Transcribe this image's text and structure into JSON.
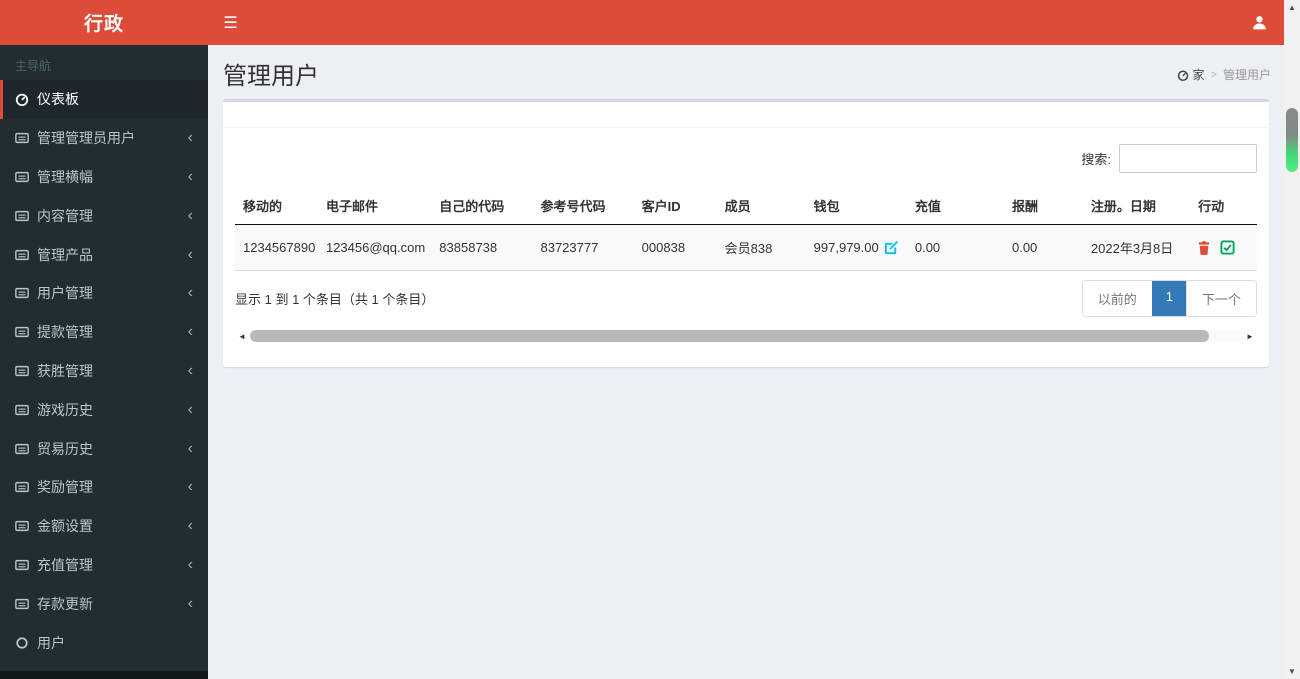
{
  "app": {
    "logo_text": "行政",
    "colors": {
      "accent_red": "#dd4b39",
      "sidebar_bg": "#222d32",
      "active_page_blue": "#337ab7",
      "edit_icon_cyan": "#00c0ef",
      "delete_icon_red": "#dd4b39",
      "check_icon_green": "#00a65a"
    }
  },
  "icons": {
    "hamburger": "☰",
    "chevron_left": "‹",
    "breadcrumb_separator": ">",
    "scroll_left": "◄",
    "scroll_right": "►",
    "scroll_up": "▲",
    "scroll_down": "▼"
  },
  "sidebar": {
    "section_label": "主导航",
    "items": [
      {
        "label": "仪表板",
        "icon": "dashboard-icon",
        "active": true,
        "chevron": false
      },
      {
        "label": "管理管理员用户",
        "icon": "list-icon",
        "active": false,
        "chevron": true
      },
      {
        "label": "管理横幅",
        "icon": "list-icon",
        "active": false,
        "chevron": true
      },
      {
        "label": "内容管理",
        "icon": "list-icon",
        "active": false,
        "chevron": true
      },
      {
        "label": "管理产品",
        "icon": "list-icon",
        "active": false,
        "chevron": true
      },
      {
        "label": "用户管理",
        "icon": "list-icon",
        "active": false,
        "chevron": true
      },
      {
        "label": "提款管理",
        "icon": "list-icon",
        "active": false,
        "chevron": true
      },
      {
        "label": "获胜管理",
        "icon": "list-icon",
        "active": false,
        "chevron": true
      },
      {
        "label": "游戏历史",
        "icon": "list-icon",
        "active": false,
        "chevron": true
      },
      {
        "label": "贸易历史",
        "icon": "list-icon",
        "active": false,
        "chevron": true
      },
      {
        "label": "奖励管理",
        "icon": "list-icon",
        "active": false,
        "chevron": true
      },
      {
        "label": "金额设置",
        "icon": "list-icon",
        "active": false,
        "chevron": true
      },
      {
        "label": "充值管理",
        "icon": "list-icon",
        "active": false,
        "chevron": true
      },
      {
        "label": "存款更新",
        "icon": "list-icon",
        "active": false,
        "chevron": true
      },
      {
        "label": "用户",
        "icon": "circle-icon",
        "active": false,
        "chevron": false
      }
    ]
  },
  "page": {
    "title": "管理用户",
    "breadcrumb": {
      "home_label": "家",
      "current": "管理用户"
    }
  },
  "search": {
    "label": "搜索:",
    "value": ""
  },
  "table": {
    "headers": [
      "移动的",
      "电子邮件",
      "自己的代码",
      "参考号代码",
      "客户ID",
      "成员",
      "钱包",
      "充值",
      "报酬",
      "注册。日期",
      "行动"
    ],
    "rows": [
      {
        "mobile": "1234567890",
        "email": "123456@qq.com",
        "own_code": "83858738",
        "ref_code": "83723777",
        "customer_id": "000838",
        "member": "会员838",
        "wallet": "997,979.00",
        "recharge": "0.00",
        "reward": "0.00",
        "reg_date": "2022年3月8日"
      }
    ]
  },
  "pagination": {
    "info": "显示 1 到 1 个条目（共 1 个条目）",
    "previous_label": "以前的",
    "current_page": "1",
    "next_label": "下一个"
  }
}
